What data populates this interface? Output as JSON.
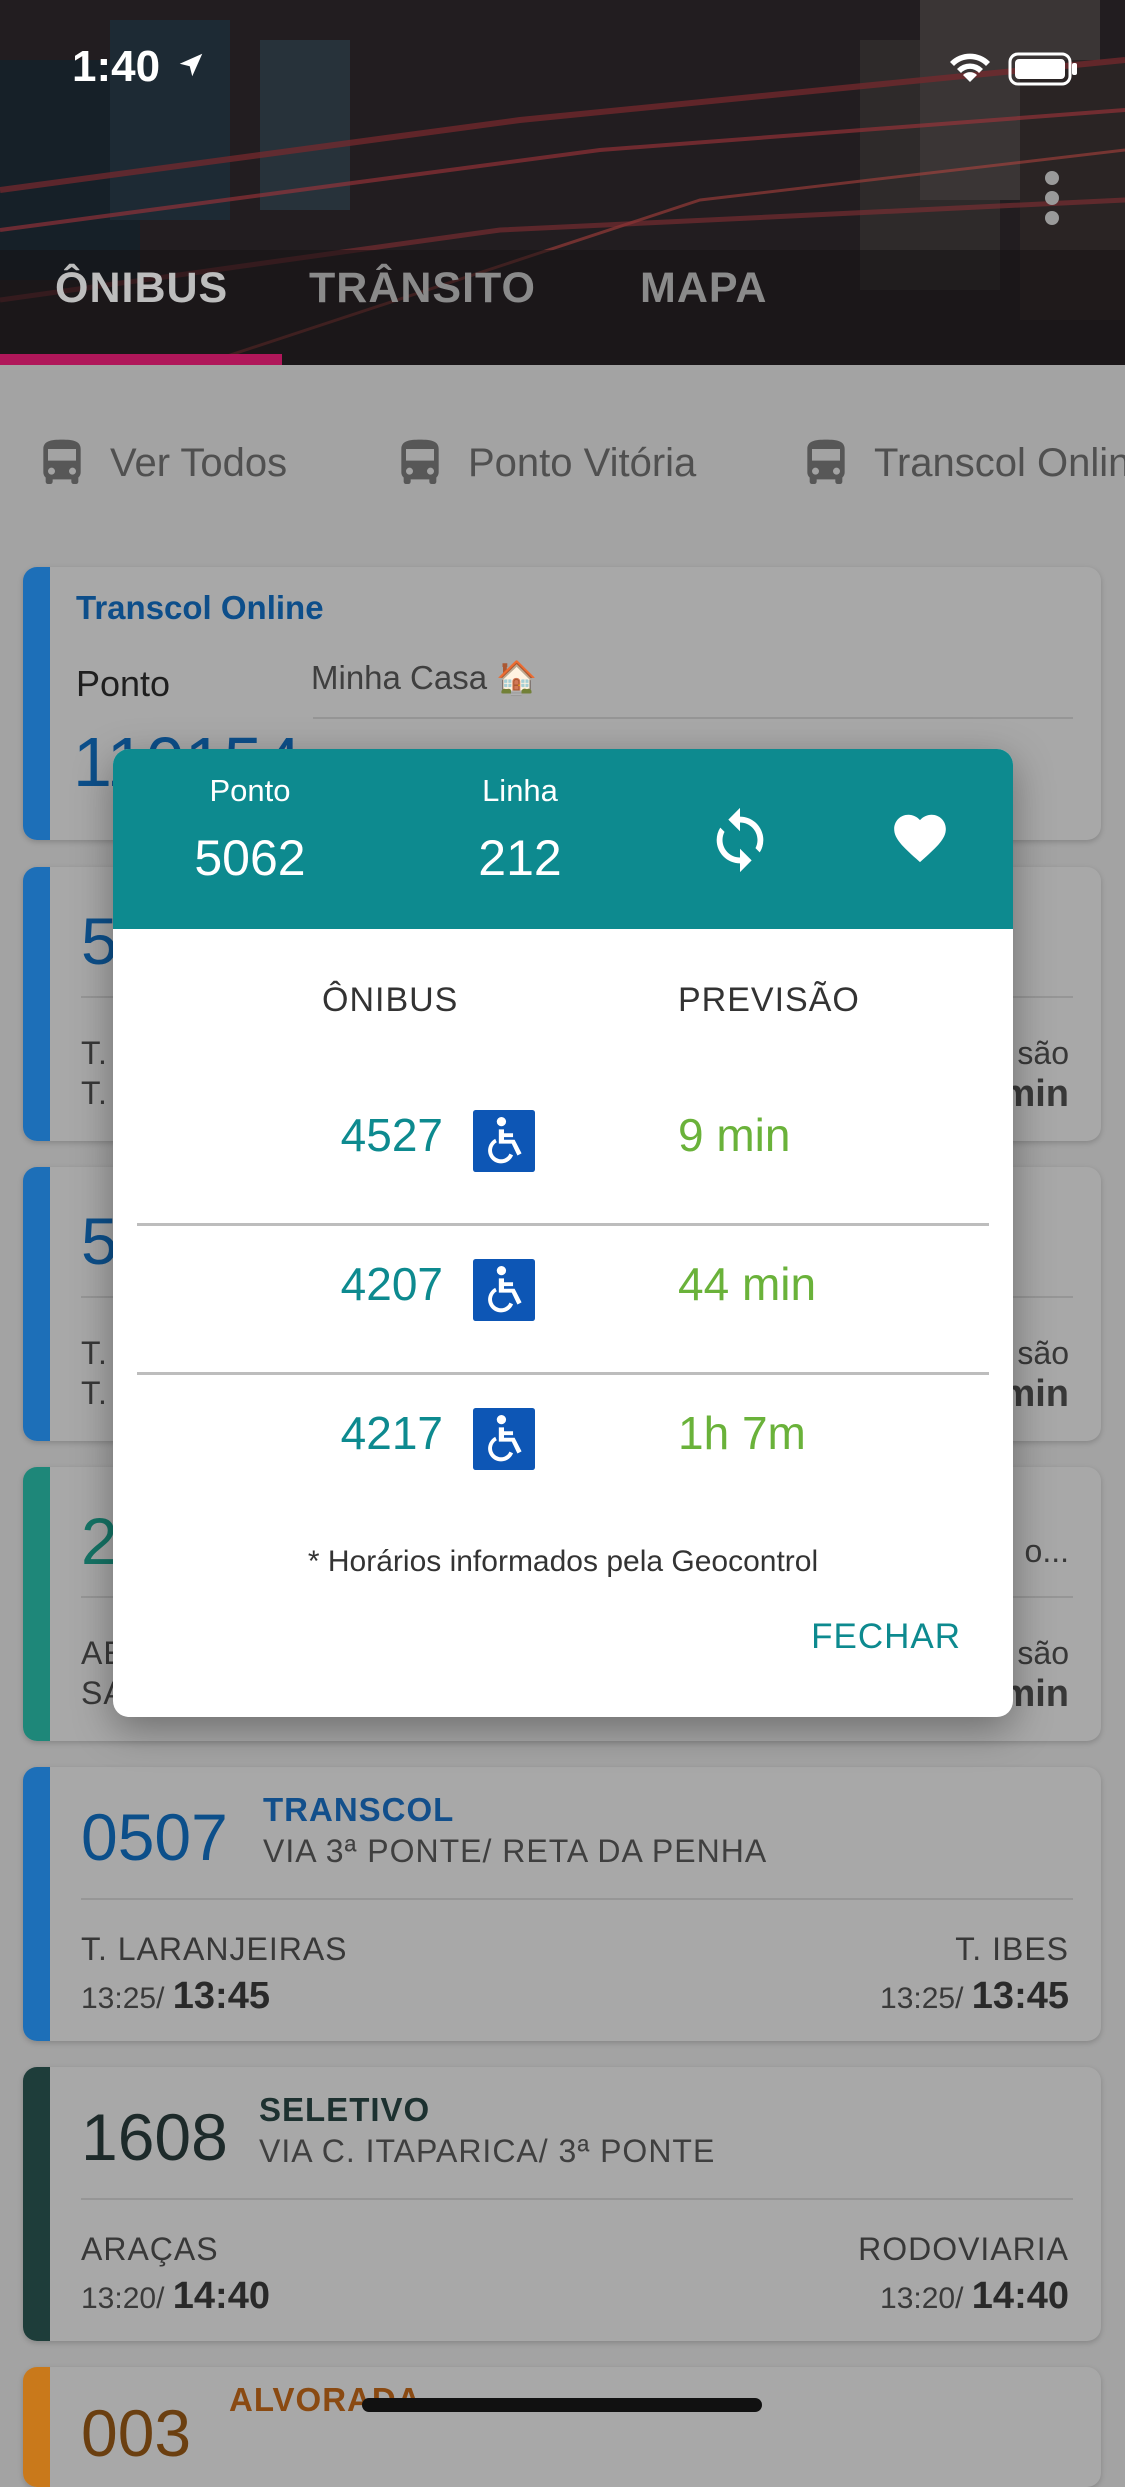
{
  "status_bar": {
    "time": "1:40"
  },
  "tabs": [
    {
      "label": "ÔNIBUS",
      "active": true
    },
    {
      "label": "TRÂNSITO",
      "active": false
    },
    {
      "label": "MAPA",
      "active": false
    }
  ],
  "colors": {
    "accent": "#b0175a",
    "teal": "#0d8a8f",
    "eta_green": "#6ab23a",
    "link_blue": "#0c4f8a"
  },
  "chips": [
    {
      "label": "Ver Todos",
      "icon": "bus-icon"
    },
    {
      "label": "Ponto Vitória",
      "icon": "bus-icon"
    },
    {
      "label": "Transcol Online",
      "icon": "bus-icon"
    }
  ],
  "favorite_card": {
    "title": "Transcol Online",
    "ponto_label": "Ponto",
    "name": "Minha Casa 🏠",
    "number": "110154"
  },
  "cards": [
    {
      "number": "5",
      "from": "T.",
      "from2": "T.",
      "right_top": "são",
      "right_bottom": "min"
    },
    {
      "number": "5",
      "from": "T.",
      "from2": "T.",
      "right_top": "são",
      "right_bottom": "min"
    },
    {
      "number": "2",
      "from": "AE",
      "from2": "SA",
      "right_top": "são",
      "right_bottom": "min",
      "top_right": "o..."
    },
    {
      "number": "0507",
      "company": "TRANSCOL",
      "route": "VIA 3ª PONTE/ RETA DA PENHA",
      "from": "T. LARANJEIRAS",
      "to": "T. IBES",
      "from_sched": "13:25/",
      "from_time": "13:45",
      "to_sched": "13:25/",
      "to_time": "13:45"
    },
    {
      "number": "1608",
      "company": "SELETIVO",
      "route": "VIA C. ITAPARICA/ 3ª PONTE",
      "from": "ARAÇAS",
      "to": "RODOVIARIA",
      "from_sched": "13:20/",
      "from_time": "14:40",
      "to_sched": "13:20/",
      "to_time": "14:40"
    },
    {
      "number": "003",
      "company": "ALVORADA"
    }
  ],
  "modal": {
    "ponto_label": "Ponto",
    "ponto_value": "5062",
    "linha_label": "Linha",
    "linha_value": "212",
    "col_onibus": "ÔNIBUS",
    "col_previsao": "PREVISÃO",
    "rows": [
      {
        "bus": "4527",
        "eta": "9 min"
      },
      {
        "bus": "4207",
        "eta": "44 min"
      },
      {
        "bus": "4217",
        "eta": "1h 7m"
      }
    ],
    "note": "* Horários informados pela Geocontrol",
    "close_label": "FECHAR"
  }
}
